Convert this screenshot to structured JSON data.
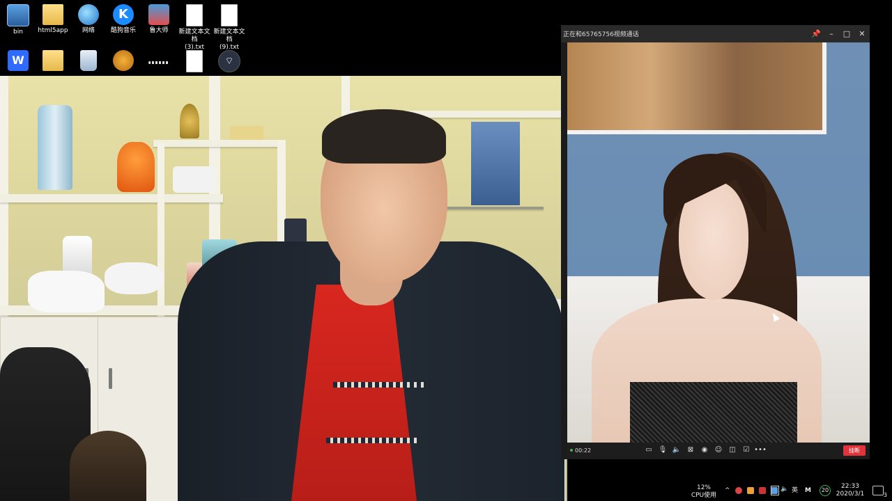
{
  "desktop": {
    "icons": [
      {
        "label": "bin",
        "kind": "bin"
      },
      {
        "label": "html5app",
        "kind": "folder"
      },
      {
        "label": "网络",
        "kind": "network"
      },
      {
        "label": "酷狗音乐",
        "kind": "kugou",
        "glyph": "K"
      },
      {
        "label": "鲁大师",
        "kind": "ludashi"
      },
      {
        "label": "新建文本文档\n(3).txt",
        "kind": "text-file"
      },
      {
        "label": "新建文本文档\n(9).txt",
        "kind": "text-file"
      }
    ],
    "row2_icons": [
      {
        "kind": "wps",
        "glyph": "W"
      },
      {
        "kind": "folder"
      },
      {
        "kind": "recycle-bin"
      },
      {
        "kind": "bear-app"
      },
      {
        "kind": "dots"
      },
      {
        "kind": "text-file"
      },
      {
        "kind": "wifi-app",
        "glyph": "⌔"
      }
    ]
  },
  "call_window": {
    "title": "正在和65765756视频通话",
    "buttons": {
      "pin": "📌",
      "minimize": "–",
      "maximize": "□",
      "close": "✕"
    },
    "timer": "00:22",
    "controls": [
      "message-icon",
      "mic-icon",
      "speaker-icon",
      "camera-off-icon",
      "screenshot-icon",
      "face-icon",
      "layout-icon",
      "edit-icon",
      "more-icon"
    ],
    "control_glyphs": [
      "▭",
      "🎙",
      "🔈",
      "⊠",
      "◉",
      "☺",
      "◫",
      "☑",
      "•••"
    ],
    "hangup_label": "挂断",
    "hangup_color": "#e0333a"
  },
  "taskbar": {
    "cpu_percent": "12%",
    "cpu_label": "CPU使用",
    "ime_lang": "英",
    "ime_mode": "M",
    "badge_number": "20",
    "time": "22:33",
    "date": "2020/3/1",
    "notification_count": "3"
  }
}
